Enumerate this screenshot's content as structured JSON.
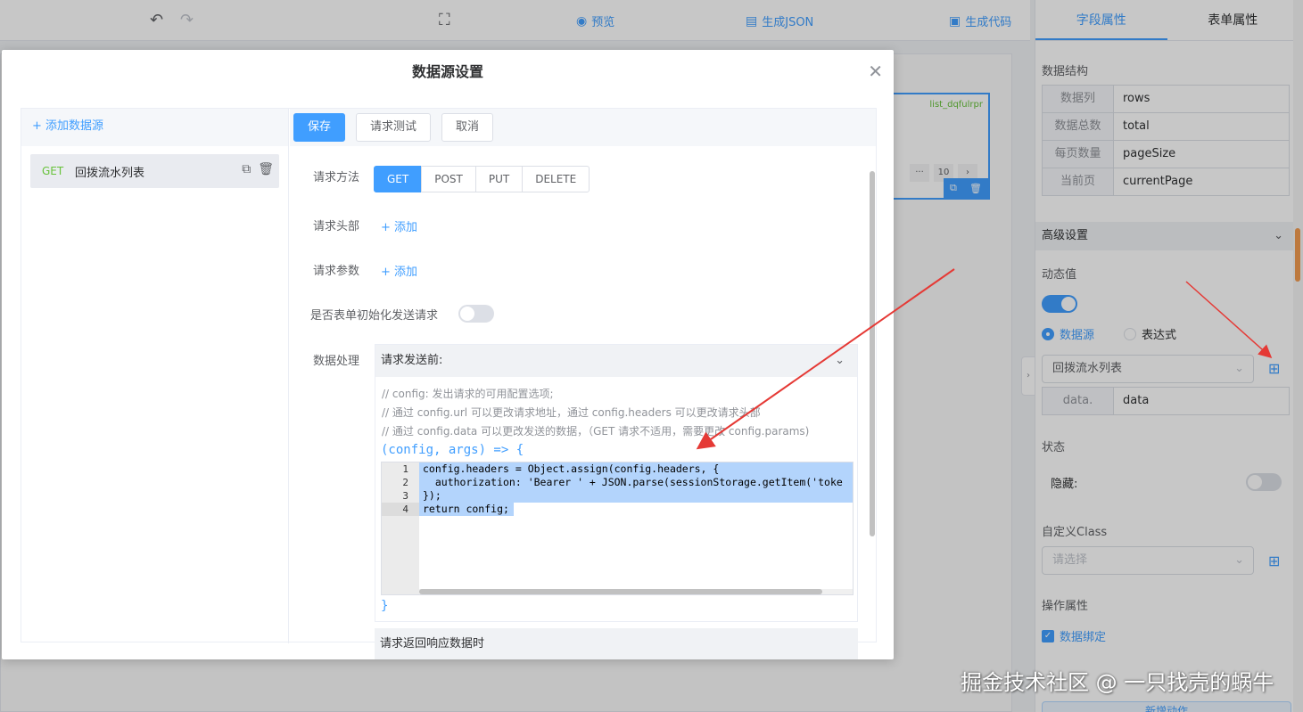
{
  "toolbar": {
    "preview_label": "预览",
    "json_label": "生成JSON",
    "code_label": "生成代码"
  },
  "widget": {
    "tag": "list_dqfulrpr",
    "pager": [
      "···",
      "10",
      "›"
    ]
  },
  "right_panel": {
    "tabs": [
      "字段属性",
      "表单属性"
    ],
    "data_structure_title": "数据结构",
    "data_structure": [
      {
        "key": "数据列",
        "value": "rows"
      },
      {
        "key": "数据总数",
        "value": "total"
      },
      {
        "key": "每页数量",
        "value": "pageSize"
      },
      {
        "key": "当前页",
        "value": "currentPage"
      }
    ],
    "advanced_title": "高级设置",
    "dynamic_title": "动态值",
    "radio_datasource": "数据源",
    "radio_expression": "表达式",
    "datasource_selected": "回拨流水列表",
    "data_key": "data.",
    "data_value": "data",
    "state_title": "状态",
    "hidden_label": "隐藏:",
    "custom_class_title": "自定义Class",
    "custom_class_placeholder": "请选择",
    "operation_title": "操作属性",
    "bind_label": "数据绑定",
    "new_action_label": "新增动作"
  },
  "dialog": {
    "title": "数据源设置",
    "add_datasource": "+ 添加数据源",
    "datasource_item": {
      "method": "GET",
      "name": "回拨流水列表"
    },
    "buttons": {
      "save": "保存",
      "test": "请求测试",
      "cancel": "取消"
    },
    "labels": {
      "method": "请求方法",
      "headers": "请求头部",
      "params": "请求参数",
      "init_send": "是否表单初始化发送请求",
      "data_processing": "数据处理"
    },
    "methods": [
      "GET",
      "POST",
      "PUT",
      "DELETE"
    ],
    "add_link": "+ 添加",
    "before_send_title": "请求发送前:",
    "comments": [
      "// config: 发出请求的可用配置选项;",
      "// 通过 config.url 可以更改请求地址，通过 config.headers 可以更改请求头部",
      "// 通过 config.data 可以更改发送的数据，（GET 请求不适用，需要更改 config.params)"
    ],
    "fn_signature": "(config, args) => {",
    "fn_close": "}",
    "code_lines": [
      "config.headers = Object.assign(config.headers, {",
      "  authorization: 'Bearer ' + JSON.parse(sessionStorage.getItem('toke",
      "});",
      "return config;"
    ],
    "line_numbers": [
      "1",
      "2",
      "3",
      "4"
    ],
    "after_response_title": "请求返回响应数据时"
  },
  "watermark": "掘金技术社区 @ 一只找壳的蜗牛",
  "colors": {
    "primary": "#409eff",
    "success": "#67c23a",
    "annotation_arrow": "#e53935"
  }
}
